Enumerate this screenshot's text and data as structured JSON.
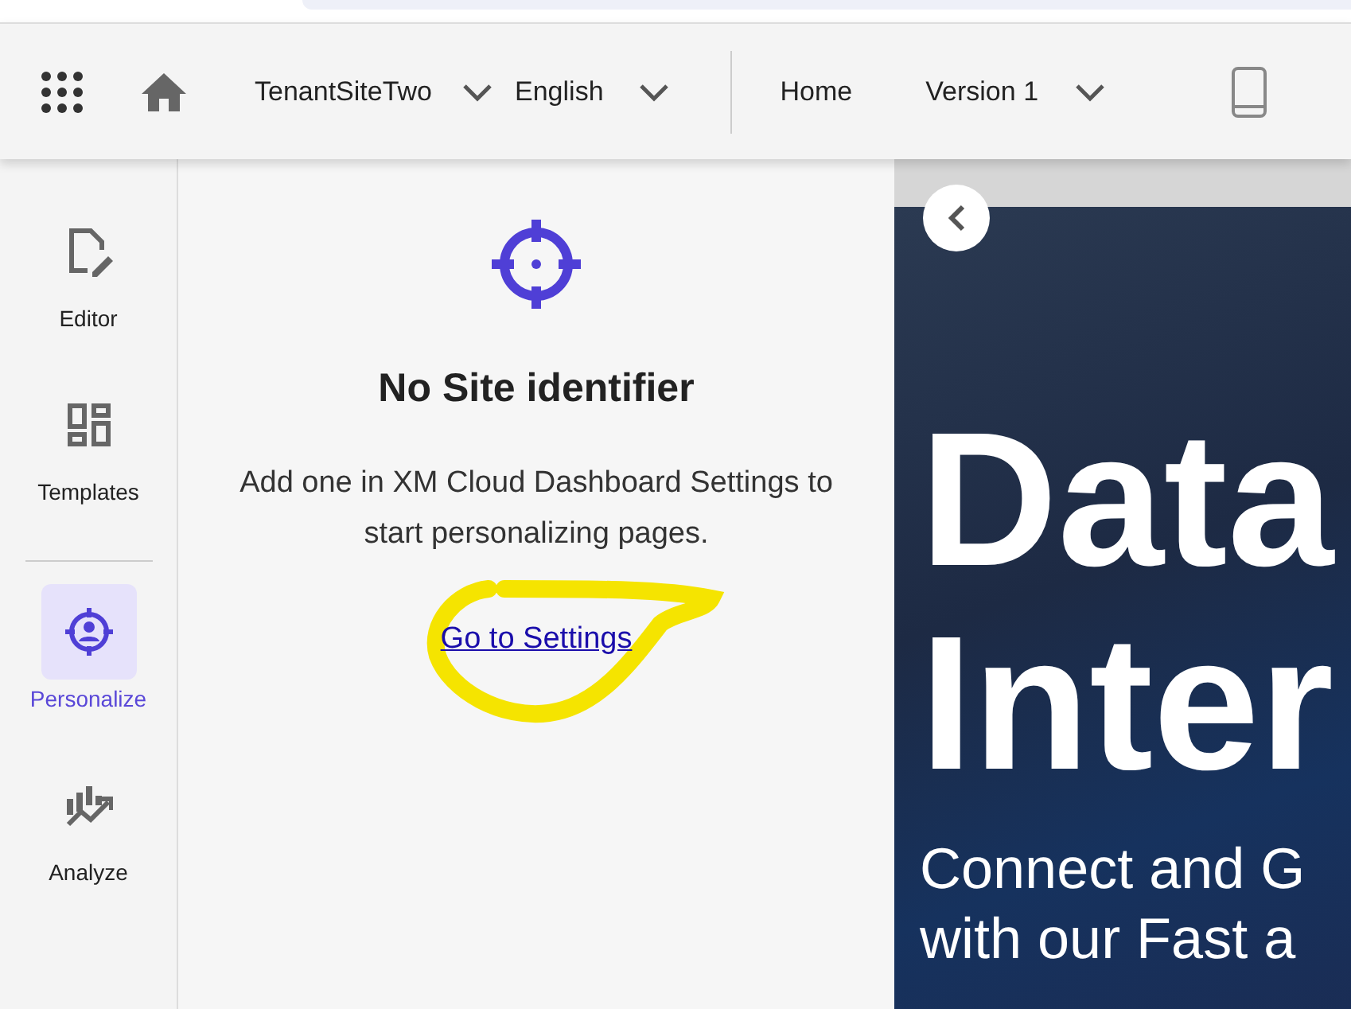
{
  "topbar": {
    "site": "TenantSiteTwo",
    "language": "English",
    "page": "Home",
    "version": "Version 1"
  },
  "sidebar": {
    "items": [
      {
        "label": "Editor",
        "kind": "editor",
        "selected": false
      },
      {
        "label": "Templates",
        "kind": "templates",
        "selected": false
      },
      {
        "label": "Personalize",
        "kind": "personalize",
        "selected": true
      },
      {
        "label": "Analyze",
        "kind": "analyze",
        "selected": false
      }
    ]
  },
  "panel": {
    "title": "No Site identifier",
    "message": "Add one in XM Cloud Dashboard Settings to start personalizing pages.",
    "link": "Go to Settings"
  },
  "preview": {
    "headline": [
      "Data",
      "Inter"
    ],
    "subline": [
      "Connect and G",
      "with our Fast a"
    ]
  }
}
